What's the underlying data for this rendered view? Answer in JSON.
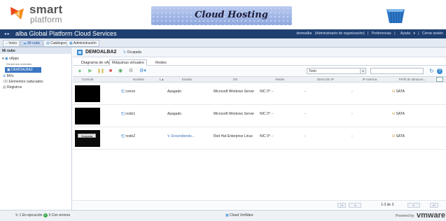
{
  "header": {
    "logo_word": "smart",
    "logo_sub": "platform",
    "hosting_text": "Cloud Hosting"
  },
  "topnav": {
    "app_title": "alba Global Platform Cloud Services",
    "user": "demoalba",
    "role": "(Administrador de organización)",
    "preferences": "Preferencias",
    "help": "Ayuda",
    "logout": "Cerrar sesión"
  },
  "workspace_tabs": [
    "Inicio",
    "Mi nube",
    "Catálogos",
    "Administración"
  ],
  "left_panel": {
    "title": "Mi nube",
    "vapps": "vApps",
    "recent": "Elementos recientes",
    "selected_item": "DEMOALBA2",
    "vms": "MVs",
    "expired": "Elementos caducados",
    "logs": "Registros"
  },
  "vapp": {
    "name": "DEMOALBA2",
    "state": "Ocupada"
  },
  "subtabs": [
    "Diagrama de vApp",
    "Máquinas virtuales",
    "Redes"
  ],
  "toolbar": {
    "filter_value": "Todo"
  },
  "table": {
    "columns": [
      "Consola",
      "Nombre",
      "1▲",
      "Estado",
      "SO",
      "Redes",
      "Dirección IP",
      "IP externa",
      "Perfil de almacen..."
    ],
    "rows": [
      {
        "name": "correo",
        "state": "Apagado",
        "os": "Microsoft Windows Server",
        "networks": "NIC 0*:  -",
        "ip": "-",
        "ext_ip": "-",
        "storage": "SATA",
        "console": ""
      },
      {
        "name": "nodo1",
        "state": "Apagado",
        "os": "Microsoft Windows Server",
        "networks": "NIC 0*:  -",
        "ip": "-",
        "ext_ip": "-",
        "storage": "SATA",
        "console": ""
      },
      {
        "name": "nodo2",
        "state": "Encendiendo...",
        "os": "Red Hat Enterprise Linux",
        "networks": "NIC 0*:  -",
        "ip": "-",
        "ext_ip": "-",
        "storage": "SATA",
        "console": "Ocupada"
      }
    ]
  },
  "pager": {
    "range": "1-3 de 3"
  },
  "statusbar": {
    "running": "1 En ejecución",
    "errors": "0 Con errores",
    "center": "Cloud VmWare",
    "powered": "Powered by",
    "brand": "vmware"
  }
}
